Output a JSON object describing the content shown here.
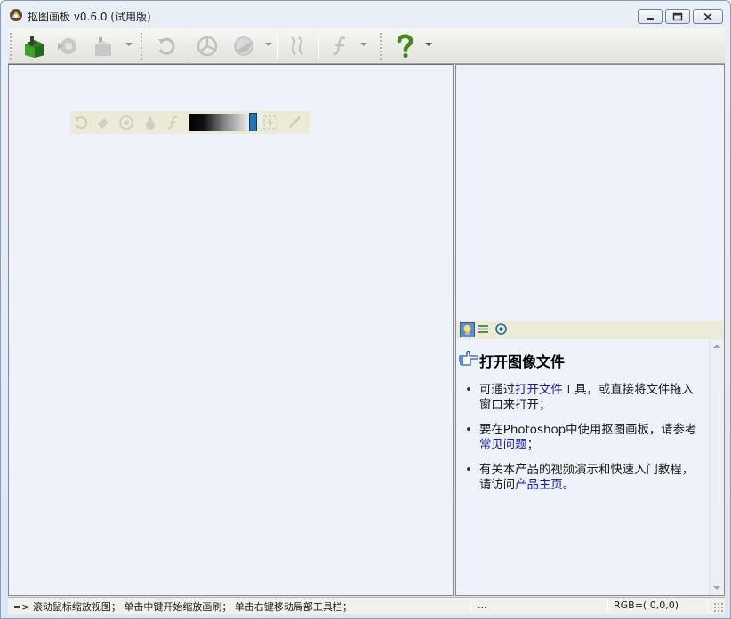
{
  "window": {
    "title": "抠图画板 v0.6.0 (试用版)",
    "minimize_icon": "minimize-icon",
    "maximize_icon": "restore-icon",
    "close_icon": "close-icon"
  },
  "toolbar": {
    "tools": [
      {
        "id": "open-image",
        "icon": "green-box-icon",
        "enabled": true
      },
      {
        "id": "recent",
        "icon": "camera-icon",
        "enabled": false
      },
      {
        "id": "export",
        "icon": "hand-box-icon",
        "enabled": false,
        "dropdown": true
      },
      {
        "id": "undo",
        "icon": "undo-icon",
        "enabled": false
      },
      {
        "id": "auto-cut",
        "icon": "aperture-icon",
        "enabled": false
      },
      {
        "id": "fill-mode",
        "icon": "half-circle-icon",
        "enabled": false,
        "dropdown": true
      },
      {
        "id": "edge",
        "icon": "wave-icon",
        "enabled": false
      },
      {
        "id": "function",
        "icon": "function-icon",
        "enabled": false,
        "dropdown": true
      },
      {
        "id": "help",
        "icon": "help-icon",
        "enabled": true,
        "dropdown": true
      }
    ]
  },
  "floating_toolbar": {
    "icons": [
      "rotate-icon",
      "eraser-icon",
      "circle-brush-icon",
      "drop-icon",
      "function-icon"
    ],
    "gradient_colors": [
      "#000000",
      "#ececec"
    ],
    "handle_color": "#2472b8",
    "extra_icons": [
      "fit-icon",
      "pipette-icon"
    ]
  },
  "help_panel": {
    "tabs": [
      "lightbulb-icon",
      "list-icon",
      "eye-icon"
    ],
    "title": "打开图像文件",
    "items": [
      {
        "before": "可通过",
        "link": "打开文件",
        "after": "工具，或直接将文件拖入窗口来打开；"
      },
      {
        "before": "要在Photoshop中使用抠图画板，请参考",
        "link": "常见问题",
        "after": "；"
      },
      {
        "before": "有关本产品的视频演示和快速入门教程，请访问",
        "link": "产品主页",
        "after": "。"
      }
    ]
  },
  "statusbar": {
    "hint": "=> 滚动鼠标缩放视图； 单击中键开始缩放画刷； 单击右键移动局部工具栏；",
    "middle": "...",
    "rgb": "RGB=( 0,0,0)"
  }
}
